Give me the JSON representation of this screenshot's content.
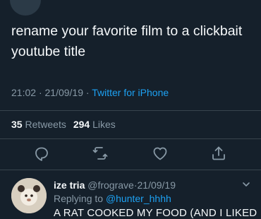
{
  "tweet": {
    "text": "rename your favorite film to a clickbait youtube title",
    "time": "21:02",
    "date": "21/09/19",
    "separator": "·",
    "source": "Twitter for iPhone"
  },
  "stats": {
    "retweets_count": "35",
    "retweets_label": "Retweets",
    "likes_count": "294",
    "likes_label": "Likes"
  },
  "actions": {
    "icons": [
      "reply-icon",
      "retweet-icon",
      "like-icon",
      "share-icon"
    ]
  },
  "reply": {
    "display_name": "ize tria",
    "handle": "@frograve",
    "separator": "·",
    "date": "21/09/19",
    "replying_prefix": "Replying to",
    "replying_to": "@hunter_hhhh",
    "text": "A RAT COOKED MY FOOD (AND I LIKED"
  },
  "colors": {
    "background": "#15202b",
    "accent": "#1da1f2",
    "muted": "#8899a6",
    "divider": "#38444d"
  }
}
